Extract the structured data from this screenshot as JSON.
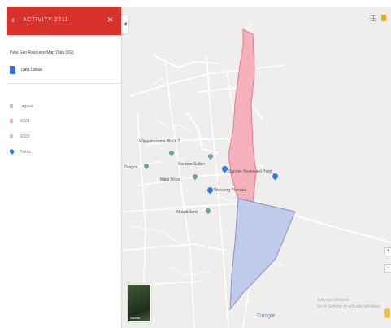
{
  "panel": {
    "title": "ACTIVITY 2711",
    "back_icon": "arrow-left-icon",
    "close_icon": "close-icon",
    "collapse_icon": "chevron-left-icon",
    "layer_name": "Peta Geo Resource Map Data (9/2)",
    "layer_item": "Data Lokasi",
    "legend": [
      {
        "label": "Legend",
        "symbol": "square",
        "color": "#bdbdbd"
      },
      {
        "label": "SC01",
        "symbol": "square",
        "color": "#f4a6b3"
      },
      {
        "label": "SC02",
        "symbol": "square",
        "color": "#b9c7ea"
      },
      {
        "label": "Points",
        "symbol": "pin",
        "color": "#2f7de1"
      }
    ]
  },
  "map": {
    "labels": [
      {
        "text": "Wijayakusuma Block 2",
        "pin": "grey"
      },
      {
        "text": "Keraton Sultan",
        "pin": "grey"
      },
      {
        "text": "Dragon",
        "pin": "grey"
      },
      {
        "text": "Balai Desa",
        "pin": "grey"
      },
      {
        "text": "Waroeng Pemuda",
        "pin": "blue"
      },
      {
        "text": "Sunrise Boulevard Point",
        "pin": "blue"
      },
      {
        "text": "Masjid Jami",
        "pin": "grey"
      }
    ],
    "polygons": [
      {
        "name": "SC01",
        "fill": "#f4a6b3",
        "stroke": "#e07b8f"
      },
      {
        "name": "SC02",
        "fill": "#b9c7ea",
        "stroke": "#8a8fc6"
      }
    ],
    "satellite_label": "Satellite",
    "google_logo": "Google",
    "attribution_line1": "Activate Windows",
    "attribution_line2": "Go to Settings to activate Windows.",
    "zoom_in": "+",
    "zoom_out": "−",
    "menu_icon": "grid-dots-icon",
    "lock_icon": "lock-icon",
    "pegman_icon": "pegman-icon"
  }
}
